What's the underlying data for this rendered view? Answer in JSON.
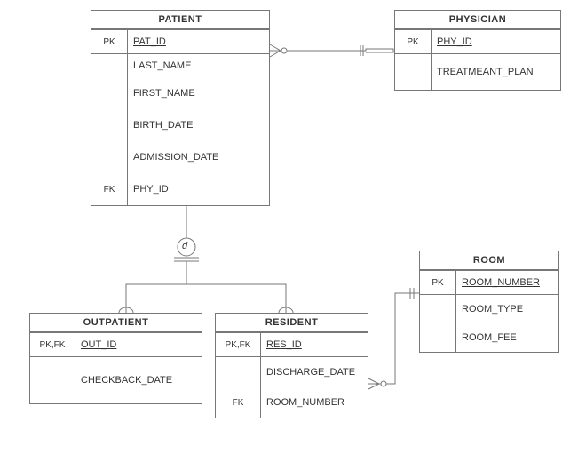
{
  "entities": {
    "patient": {
      "title": "PATIENT",
      "rows": [
        {
          "key": "PK",
          "attr": "PAT_ID",
          "underline": true
        },
        {
          "key": "",
          "attr": "LAST_NAME"
        },
        {
          "key": "",
          "attr": "FIRST_NAME"
        },
        {
          "key": "",
          "attr": "BIRTH_DATE"
        },
        {
          "key": "",
          "attr": "ADMISSION_DATE"
        },
        {
          "key": "FK",
          "attr": "PHY_ID"
        }
      ]
    },
    "physician": {
      "title": "PHYSICIAN",
      "rows": [
        {
          "key": "PK",
          "attr": "PHY_ID",
          "underline": true
        },
        {
          "key": "",
          "attr": "TREATMEANT_PLAN"
        }
      ]
    },
    "outpatient": {
      "title": "OUTPATIENT",
      "rows": [
        {
          "key": "PK,FK",
          "attr": "OUT_ID",
          "underline": true
        },
        {
          "key": "",
          "attr": "CHECKBACK_DATE"
        }
      ]
    },
    "resident": {
      "title": "RESIDENT",
      "rows": [
        {
          "key": "PK,FK",
          "attr": "RES_ID",
          "underline": true
        },
        {
          "key": "",
          "attr": "DISCHARGE_DATE"
        },
        {
          "key": "FK",
          "attr": "ROOM_NUMBER"
        }
      ]
    },
    "room": {
      "title": "ROOM",
      "rows": [
        {
          "key": "PK",
          "attr": "ROOM_NUMBER",
          "underline": true
        },
        {
          "key": "",
          "attr": "ROOM_TYPE"
        },
        {
          "key": "",
          "attr": "ROOM_FEE"
        }
      ]
    }
  },
  "disjoint_label": "d"
}
